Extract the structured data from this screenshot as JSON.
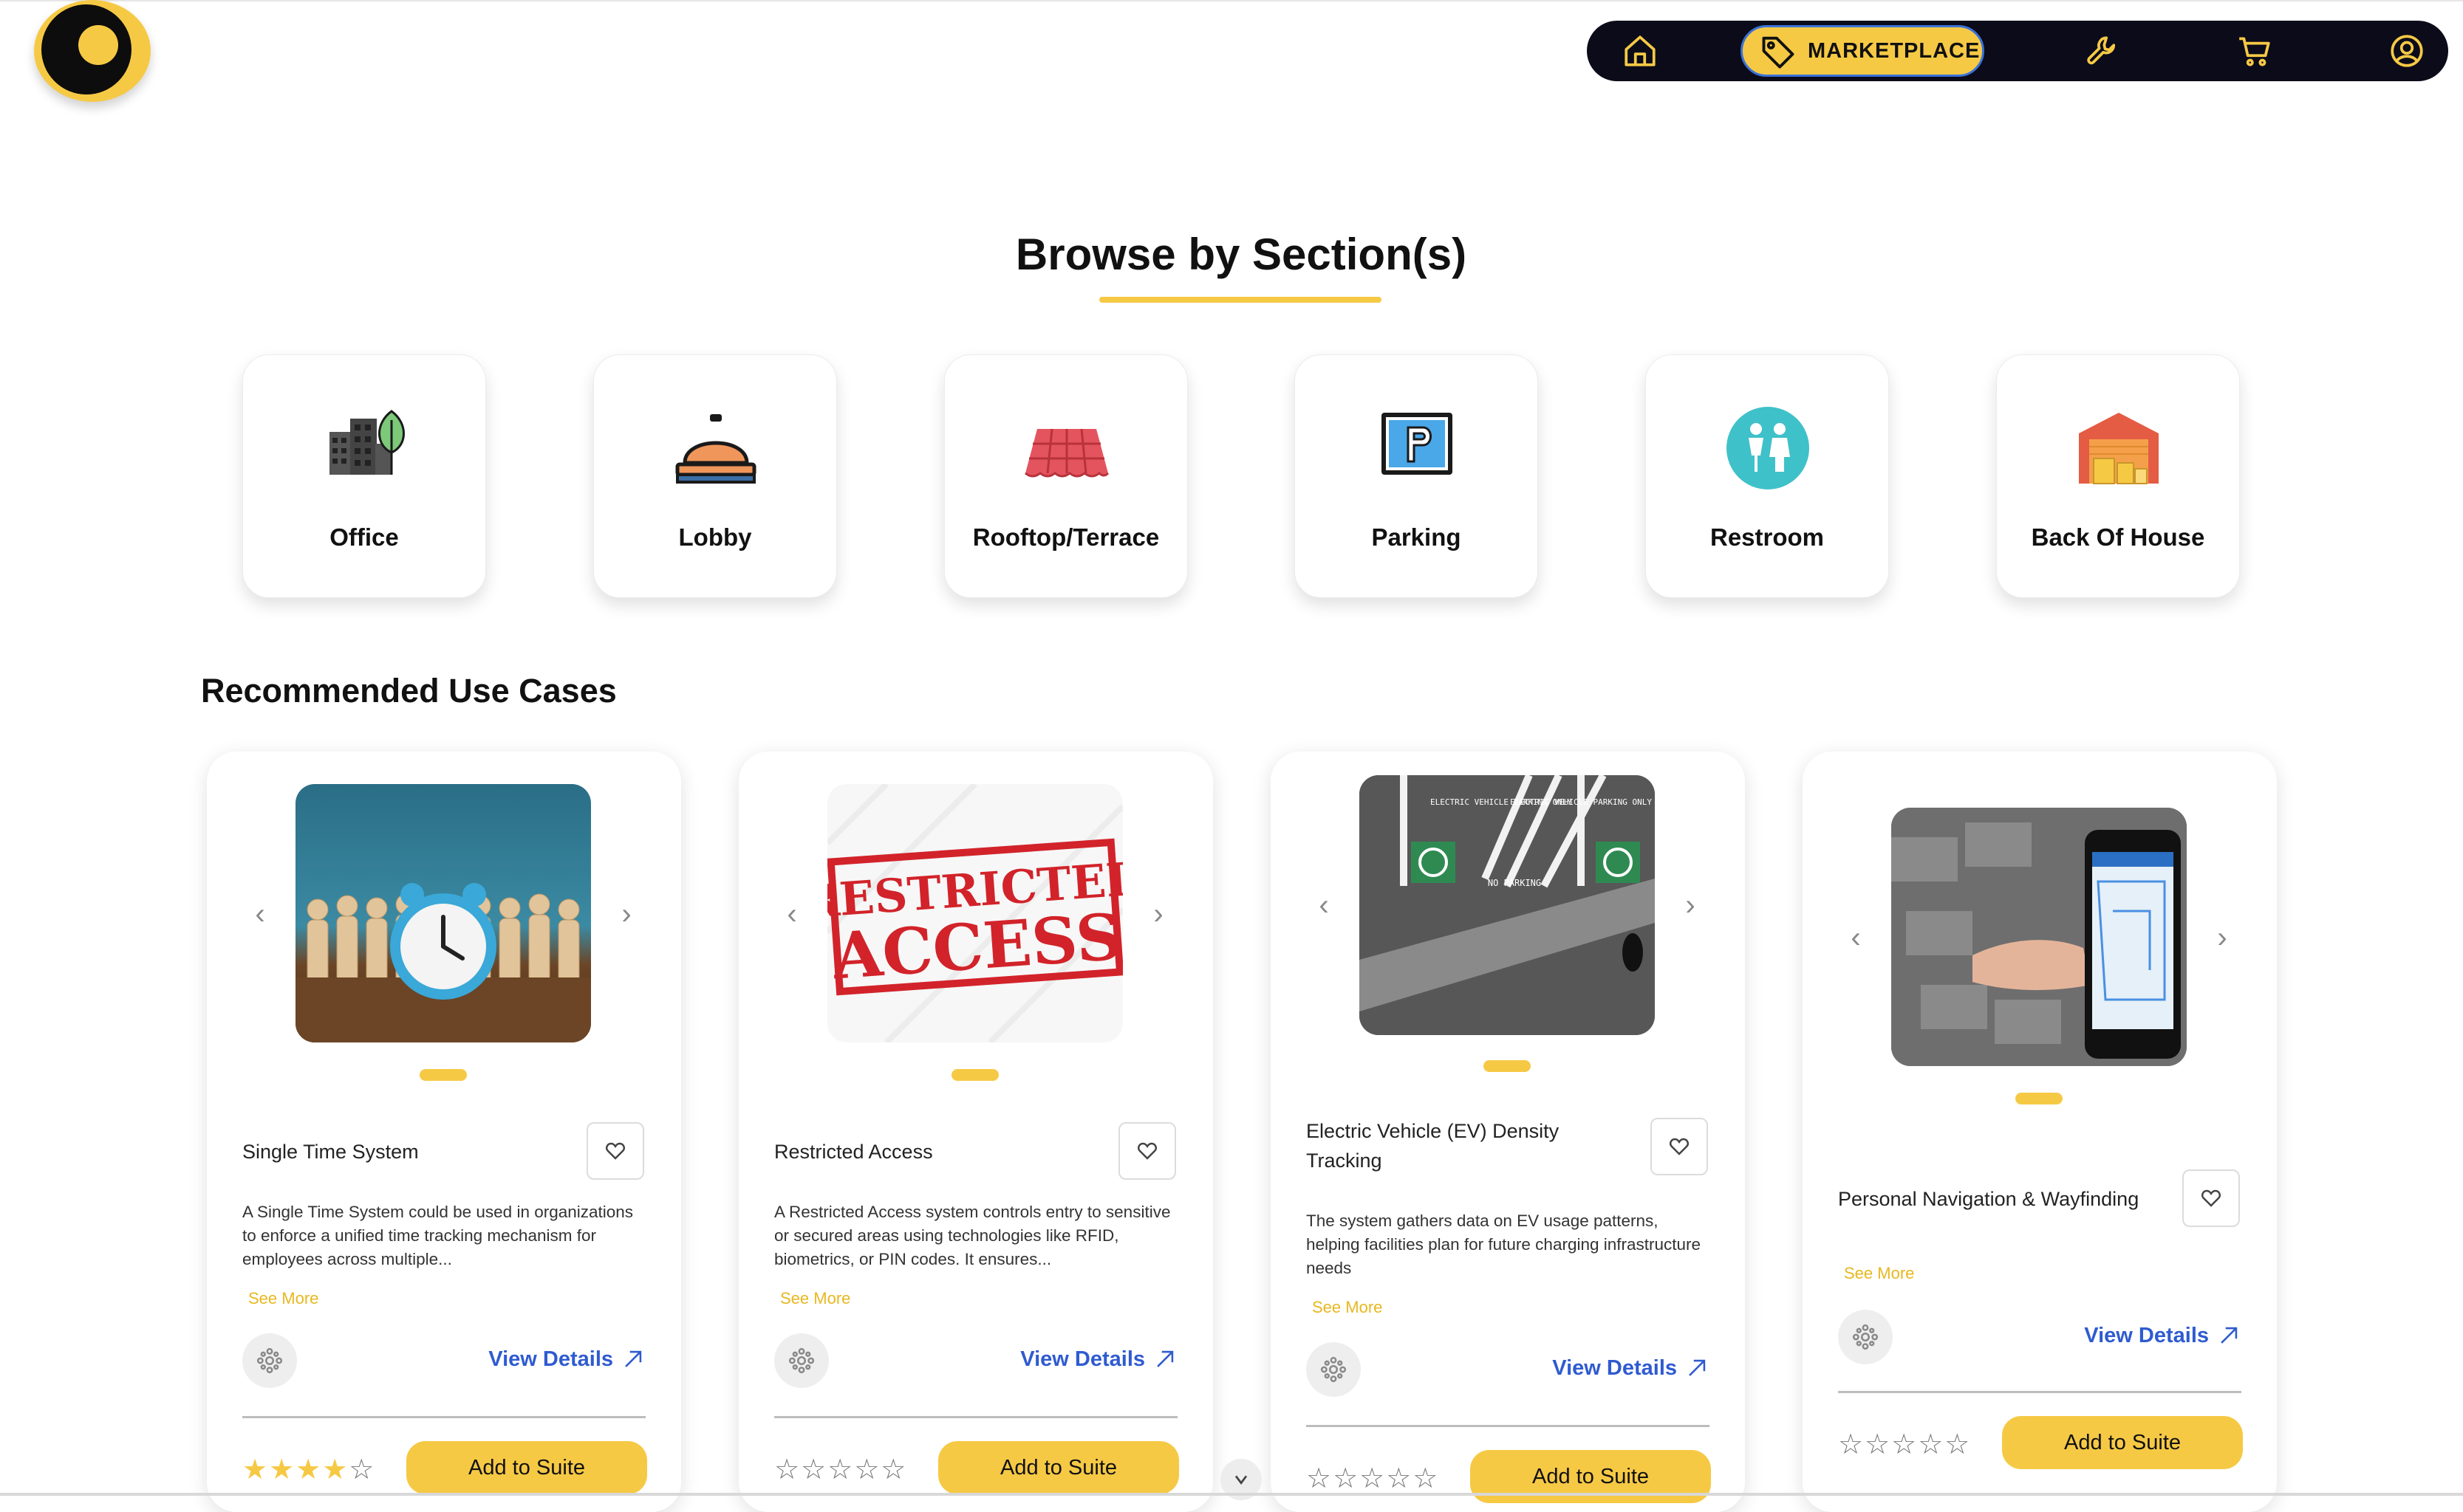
{
  "nav": {
    "marketplace_label": "MARKETPLACE",
    "icons": [
      "home-icon",
      "tag-icon",
      "wrench-icon",
      "cart-icon",
      "user-icon"
    ]
  },
  "browse": {
    "title": "Browse by Section(s)",
    "sections": [
      {
        "label": "Office",
        "icon": "office-building-icon"
      },
      {
        "label": "Lobby",
        "icon": "service-bell-icon"
      },
      {
        "label": "Rooftop/Terrace",
        "icon": "roof-tiles-icon"
      },
      {
        "label": "Parking",
        "icon": "parking-sign-icon"
      },
      {
        "label": "Restroom",
        "icon": "restroom-icon"
      },
      {
        "label": "Back Of House",
        "icon": "warehouse-icon"
      }
    ]
  },
  "recommended": {
    "title": "Recommended Use Cases",
    "cards": [
      {
        "name": "Single Time System",
        "description": "A Single Time System could be used in organizations to enforce a unified time tracking mechanism for employees across multiple...",
        "see_more": "See More",
        "view_details": "View Details",
        "rating": 4,
        "add_label": "Add to Suite",
        "image": "alarm-clock-with-wooden-figures"
      },
      {
        "name": "Restricted Access",
        "description": "A Restricted Access system controls entry to sensitive or secured areas using technologies like RFID, biometrics, or PIN codes. It ensures...",
        "see_more": "See More",
        "view_details": "View Details",
        "rating": 0,
        "add_label": "Add to Suite",
        "image": "restricted-access-stamp",
        "stamp_line1": "RESTRICTED",
        "stamp_line2": "ACCESS"
      },
      {
        "name": "Electric Vehicle (EV) Density Tracking",
        "description": "The system gathers data on EV usage patterns, helping facilities plan for future charging infrastructure needs",
        "see_more": "See More",
        "view_details": "View Details",
        "rating": 0,
        "add_label": "Add to Suite",
        "image": "ev-parking-aerial",
        "sign_text": "ELECTRIC VEHICLE PARKING ONLY",
        "no_parking": "NO PARKING"
      },
      {
        "name": "Personal Navigation & Wayfinding",
        "description": "",
        "see_more": "See More",
        "view_details": "View Details",
        "rating": 0,
        "add_label": "Add to Suite",
        "image": "hand-holding-phone-map"
      }
    ]
  },
  "colors": {
    "accent": "#f6c945",
    "link": "#2f5bd0",
    "nav_bg": "#0b0b1a"
  }
}
